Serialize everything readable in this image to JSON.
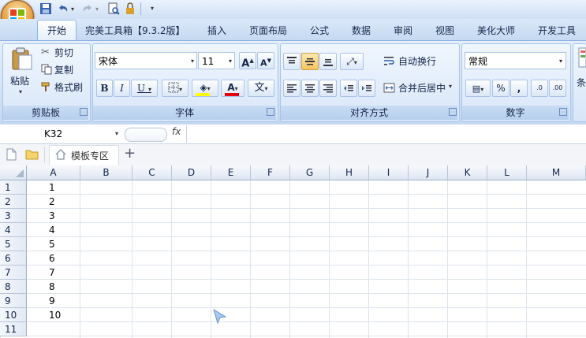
{
  "ribbon_tabs": [
    {
      "label": "开始"
    },
    {
      "label": "完美工具箱【9.3.2版】"
    },
    {
      "label": "插入"
    },
    {
      "label": "页面布局"
    },
    {
      "label": "公式"
    },
    {
      "label": "数据"
    },
    {
      "label": "审阅"
    },
    {
      "label": "视图"
    },
    {
      "label": "美化大师"
    },
    {
      "label": "开发工具"
    }
  ],
  "clipboard": {
    "paste": "粘贴",
    "cut": "剪切",
    "copy": "复制",
    "format_painter": "格式刷",
    "group_label": "剪贴板"
  },
  "font": {
    "name": "宋体",
    "size": "11",
    "group_label": "字体",
    "bold": "B",
    "italic": "I",
    "underline": "U",
    "grow": "A",
    "shrink": "A",
    "font_color": "A",
    "phonetic": "文"
  },
  "alignment": {
    "wrap_text": "自动换行",
    "merge_center": "合并后居中",
    "group_label": "对齐方式"
  },
  "number": {
    "format": "常规",
    "percent": "%",
    "comma": ",",
    "inc_decimal": ".0",
    "dec_decimal": ".00",
    "group_label": "数字",
    "styles_partial": "条"
  },
  "formula_bar": {
    "name_box": "K32",
    "fx": "fx",
    "value": ""
  },
  "doc_tabs": {
    "template_zone": "模板专区",
    "add": "+"
  },
  "columns": [
    "A",
    "B",
    "C",
    "D",
    "E",
    "F",
    "G",
    "H",
    "I",
    "J",
    "K",
    "L",
    "M"
  ],
  "rows": [
    {
      "num": "1",
      "a": "1"
    },
    {
      "num": "2",
      "a": "2"
    },
    {
      "num": "3",
      "a": "3"
    },
    {
      "num": "4",
      "a": "4"
    },
    {
      "num": "5",
      "a": "5"
    },
    {
      "num": "6",
      "a": "6"
    },
    {
      "num": "7",
      "a": "7"
    },
    {
      "num": "8",
      "a": "8"
    },
    {
      "num": "9",
      "a": "9"
    },
    {
      "num": "10",
      "a": "10"
    },
    {
      "num": "11",
      "a": ""
    }
  ],
  "icons": {
    "office_button": "office-logo-icon",
    "save": "save-icon",
    "undo": "undo-icon",
    "redo": "redo-icon",
    "print_preview": "print-preview-icon",
    "new_doc": "new-document-icon",
    "open_folder": "folder-icon",
    "home": "home-icon",
    "cursor": "mouse-cursor-icon"
  },
  "colors": {
    "accent": "#c5d9f1",
    "highlight": "#f7c55b",
    "font_color_bar": "#e60012",
    "fill_bar": "#ffff00"
  }
}
